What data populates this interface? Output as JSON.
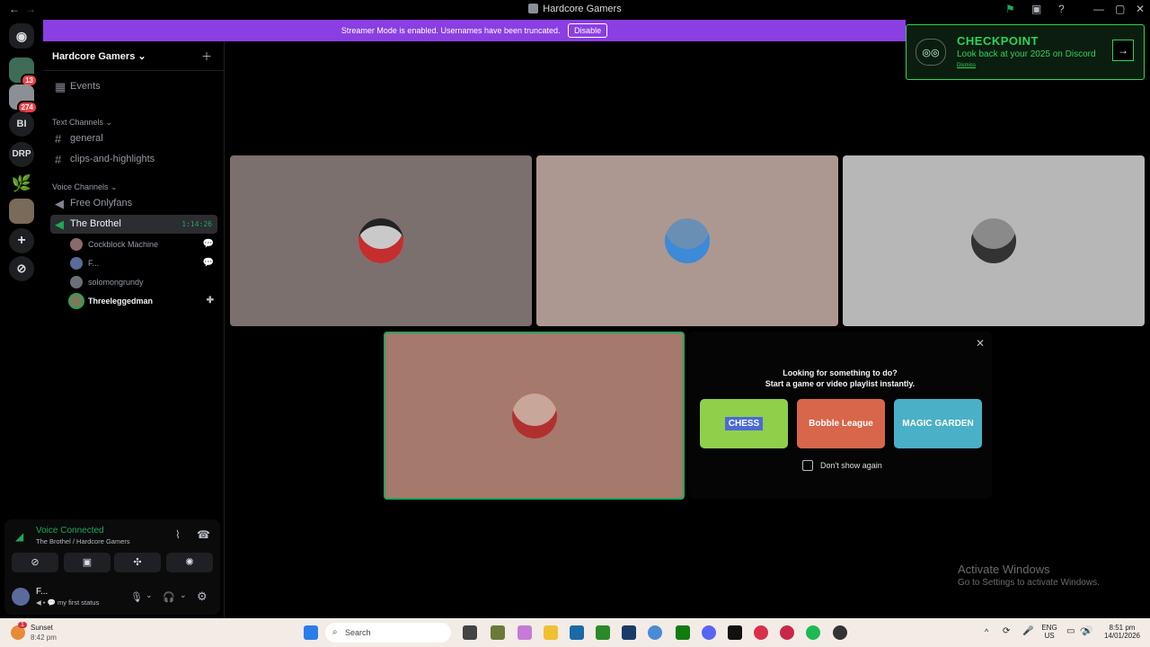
{
  "window": {
    "title": "Hardcore Gamers",
    "back": "←",
    "forward": "→"
  },
  "banner": {
    "text": "Streamer Mode is enabled. Usernames have been truncated.",
    "button": "Disable"
  },
  "checkpoint": {
    "title": "CHECKPOINT",
    "subtitle": "Look back at your 2025 on Discord",
    "dismiss": "Dismiss",
    "arrow": "→"
  },
  "servers": [
    {
      "label": "",
      "badge": "13"
    },
    {
      "label": "",
      "badge": "274"
    },
    {
      "label": "BI",
      "badge": ""
    },
    {
      "label": "DRP",
      "badge": ""
    }
  ],
  "guild": {
    "name": "Hardcore Gamers",
    "chevron": "⌄",
    "add_icon": "＋"
  },
  "events": {
    "label": "Events"
  },
  "text_channels": {
    "title": "Text Channels",
    "items": [
      "general",
      "clips-and-highlights"
    ]
  },
  "voice_channels": {
    "title": "Voice Channels",
    "items": [
      "Free Onlyfans",
      "The Brothel"
    ],
    "timer": "1:14:26"
  },
  "voice_users": [
    {
      "name": "Cockblock Machine",
      "right": "💬"
    },
    {
      "name": "F...",
      "right": "💬"
    },
    {
      "name": "solomongrundy",
      "right": ""
    },
    {
      "name": "Threeleggedman",
      "right": "✚"
    }
  ],
  "voice_panel": {
    "status": "Voice Connected",
    "location": "The Brothel / Hardcore Gamers",
    "user": "F...",
    "user_status": "my first status"
  },
  "activity": {
    "line1": "Looking for something to do?",
    "line2": "Start a game or video playlist instantly.",
    "games": [
      "CHESS",
      "Bobble League",
      "MAGIC GARDEN"
    ],
    "dont_show": "Don't show again",
    "close": "✕"
  },
  "watermark": {
    "title": "Activate Windows",
    "subtitle": "Go to Settings to activate Windows."
  },
  "taskbar": {
    "weather_name": "Sunset",
    "weather_time": "8:42 pm",
    "weather_badge": "1",
    "search": "Search",
    "lang": "ENG",
    "region": "US",
    "time": "8:51 pm",
    "date": "14/01/2026"
  },
  "colors": {
    "accent": "#8b3fe3",
    "green": "#23a55a",
    "checkpoint": "#2bd45a"
  }
}
